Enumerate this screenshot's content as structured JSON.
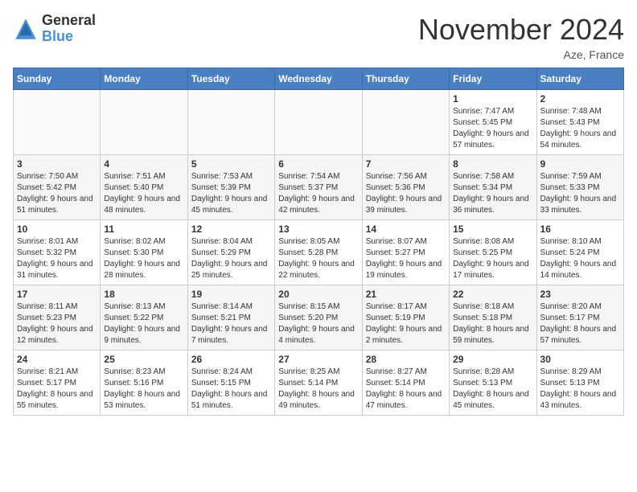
{
  "logo": {
    "general": "General",
    "blue": "Blue"
  },
  "title": "November 2024",
  "location": "Aze, France",
  "days_of_week": [
    "Sunday",
    "Monday",
    "Tuesday",
    "Wednesday",
    "Thursday",
    "Friday",
    "Saturday"
  ],
  "weeks": [
    [
      {
        "day": "",
        "info": ""
      },
      {
        "day": "",
        "info": ""
      },
      {
        "day": "",
        "info": ""
      },
      {
        "day": "",
        "info": ""
      },
      {
        "day": "",
        "info": ""
      },
      {
        "day": "1",
        "info": "Sunrise: 7:47 AM\nSunset: 5:45 PM\nDaylight: 9 hours and 57 minutes."
      },
      {
        "day": "2",
        "info": "Sunrise: 7:48 AM\nSunset: 5:43 PM\nDaylight: 9 hours and 54 minutes."
      }
    ],
    [
      {
        "day": "3",
        "info": "Sunrise: 7:50 AM\nSunset: 5:42 PM\nDaylight: 9 hours and 51 minutes."
      },
      {
        "day": "4",
        "info": "Sunrise: 7:51 AM\nSunset: 5:40 PM\nDaylight: 9 hours and 48 minutes."
      },
      {
        "day": "5",
        "info": "Sunrise: 7:53 AM\nSunset: 5:39 PM\nDaylight: 9 hours and 45 minutes."
      },
      {
        "day": "6",
        "info": "Sunrise: 7:54 AM\nSunset: 5:37 PM\nDaylight: 9 hours and 42 minutes."
      },
      {
        "day": "7",
        "info": "Sunrise: 7:56 AM\nSunset: 5:36 PM\nDaylight: 9 hours and 39 minutes."
      },
      {
        "day": "8",
        "info": "Sunrise: 7:58 AM\nSunset: 5:34 PM\nDaylight: 9 hours and 36 minutes."
      },
      {
        "day": "9",
        "info": "Sunrise: 7:59 AM\nSunset: 5:33 PM\nDaylight: 9 hours and 33 minutes."
      }
    ],
    [
      {
        "day": "10",
        "info": "Sunrise: 8:01 AM\nSunset: 5:32 PM\nDaylight: 9 hours and 31 minutes."
      },
      {
        "day": "11",
        "info": "Sunrise: 8:02 AM\nSunset: 5:30 PM\nDaylight: 9 hours and 28 minutes."
      },
      {
        "day": "12",
        "info": "Sunrise: 8:04 AM\nSunset: 5:29 PM\nDaylight: 9 hours and 25 minutes."
      },
      {
        "day": "13",
        "info": "Sunrise: 8:05 AM\nSunset: 5:28 PM\nDaylight: 9 hours and 22 minutes."
      },
      {
        "day": "14",
        "info": "Sunrise: 8:07 AM\nSunset: 5:27 PM\nDaylight: 9 hours and 19 minutes."
      },
      {
        "day": "15",
        "info": "Sunrise: 8:08 AM\nSunset: 5:25 PM\nDaylight: 9 hours and 17 minutes."
      },
      {
        "day": "16",
        "info": "Sunrise: 8:10 AM\nSunset: 5:24 PM\nDaylight: 9 hours and 14 minutes."
      }
    ],
    [
      {
        "day": "17",
        "info": "Sunrise: 8:11 AM\nSunset: 5:23 PM\nDaylight: 9 hours and 12 minutes."
      },
      {
        "day": "18",
        "info": "Sunrise: 8:13 AM\nSunset: 5:22 PM\nDaylight: 9 hours and 9 minutes."
      },
      {
        "day": "19",
        "info": "Sunrise: 8:14 AM\nSunset: 5:21 PM\nDaylight: 9 hours and 7 minutes."
      },
      {
        "day": "20",
        "info": "Sunrise: 8:15 AM\nSunset: 5:20 PM\nDaylight: 9 hours and 4 minutes."
      },
      {
        "day": "21",
        "info": "Sunrise: 8:17 AM\nSunset: 5:19 PM\nDaylight: 9 hours and 2 minutes."
      },
      {
        "day": "22",
        "info": "Sunrise: 8:18 AM\nSunset: 5:18 PM\nDaylight: 8 hours and 59 minutes."
      },
      {
        "day": "23",
        "info": "Sunrise: 8:20 AM\nSunset: 5:17 PM\nDaylight: 8 hours and 57 minutes."
      }
    ],
    [
      {
        "day": "24",
        "info": "Sunrise: 8:21 AM\nSunset: 5:17 PM\nDaylight: 8 hours and 55 minutes."
      },
      {
        "day": "25",
        "info": "Sunrise: 8:23 AM\nSunset: 5:16 PM\nDaylight: 8 hours and 53 minutes."
      },
      {
        "day": "26",
        "info": "Sunrise: 8:24 AM\nSunset: 5:15 PM\nDaylight: 8 hours and 51 minutes."
      },
      {
        "day": "27",
        "info": "Sunrise: 8:25 AM\nSunset: 5:14 PM\nDaylight: 8 hours and 49 minutes."
      },
      {
        "day": "28",
        "info": "Sunrise: 8:27 AM\nSunset: 5:14 PM\nDaylight: 8 hours and 47 minutes."
      },
      {
        "day": "29",
        "info": "Sunrise: 8:28 AM\nSunset: 5:13 PM\nDaylight: 8 hours and 45 minutes."
      },
      {
        "day": "30",
        "info": "Sunrise: 8:29 AM\nSunset: 5:13 PM\nDaylight: 8 hours and 43 minutes."
      }
    ]
  ]
}
